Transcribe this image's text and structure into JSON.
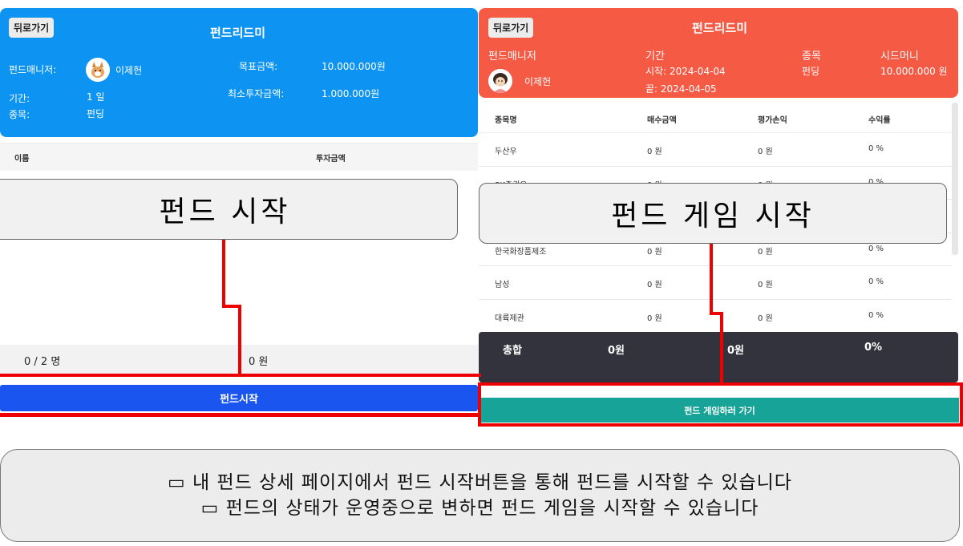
{
  "left": {
    "back_label": "뒤로가기",
    "title": "펀드리드미",
    "manager_label": "펀드매니저:",
    "manager_name": "이제헌",
    "period_label": "기간:",
    "period_value": "1 일",
    "category_label": "종목:",
    "category_value": "펀딩",
    "target_label": "목표금액:",
    "target_value": "10.000.000원",
    "min_invest_label": "최소투자금액:",
    "min_invest_value": "1.000.000원",
    "table_headers": [
      "이름",
      "투자금액"
    ],
    "summary_count": "0 / 2 명",
    "summary_amount": "0 원",
    "start_button": "펀드시작"
  },
  "right": {
    "back_label": "뒤로가기",
    "title": "펀드리드미",
    "manager_label": "펀드매니저",
    "manager_name": "이제헌",
    "period_label": "기간",
    "period_start": "시작: 2024-04-04",
    "period_end": "끝: 2024-04-05",
    "category_label": "종목",
    "category_value": "펀딩",
    "seed_label": "시드머니",
    "seed_value": "10.000.000 원",
    "table_headers": [
      "종목명",
      "매수금액",
      "평가손익",
      "수익률"
    ],
    "rows": [
      {
        "name": "두산우",
        "buy": "0 원",
        "pl": "0 원",
        "rate": "0 %"
      },
      {
        "name": "SK증권우",
        "buy": "0 원",
        "pl": "0 원",
        "rate": "0 %"
      },
      {
        "name": "",
        "buy": "",
        "pl": "",
        "rate": ""
      },
      {
        "name": "한국화장품제조",
        "buy": "0 원",
        "pl": "0 원",
        "rate": "0 %"
      },
      {
        "name": "남성",
        "buy": "0 원",
        "pl": "0 원",
        "rate": "0 %"
      },
      {
        "name": "대륙제관",
        "buy": "0 원",
        "pl": "0 원",
        "rate": "0 %"
      }
    ],
    "total_label": "총합",
    "total_buy": "0원",
    "total_pl": "0원",
    "total_rate": "0%",
    "game_button": "펀드 게임하러 가기"
  },
  "callouts": {
    "left": "펀드 시작",
    "right": "펀드 게임 시작"
  },
  "note": {
    "line1": "▭ 내 펀드 상세 페이지에서 펀드 시작버튼을 통해 펀드를 시작할 수 있습니다",
    "line2": "▭ 펀드의 상태가 운영중으로 변하면 펀드 게임을 시작할 수 있습니다"
  }
}
